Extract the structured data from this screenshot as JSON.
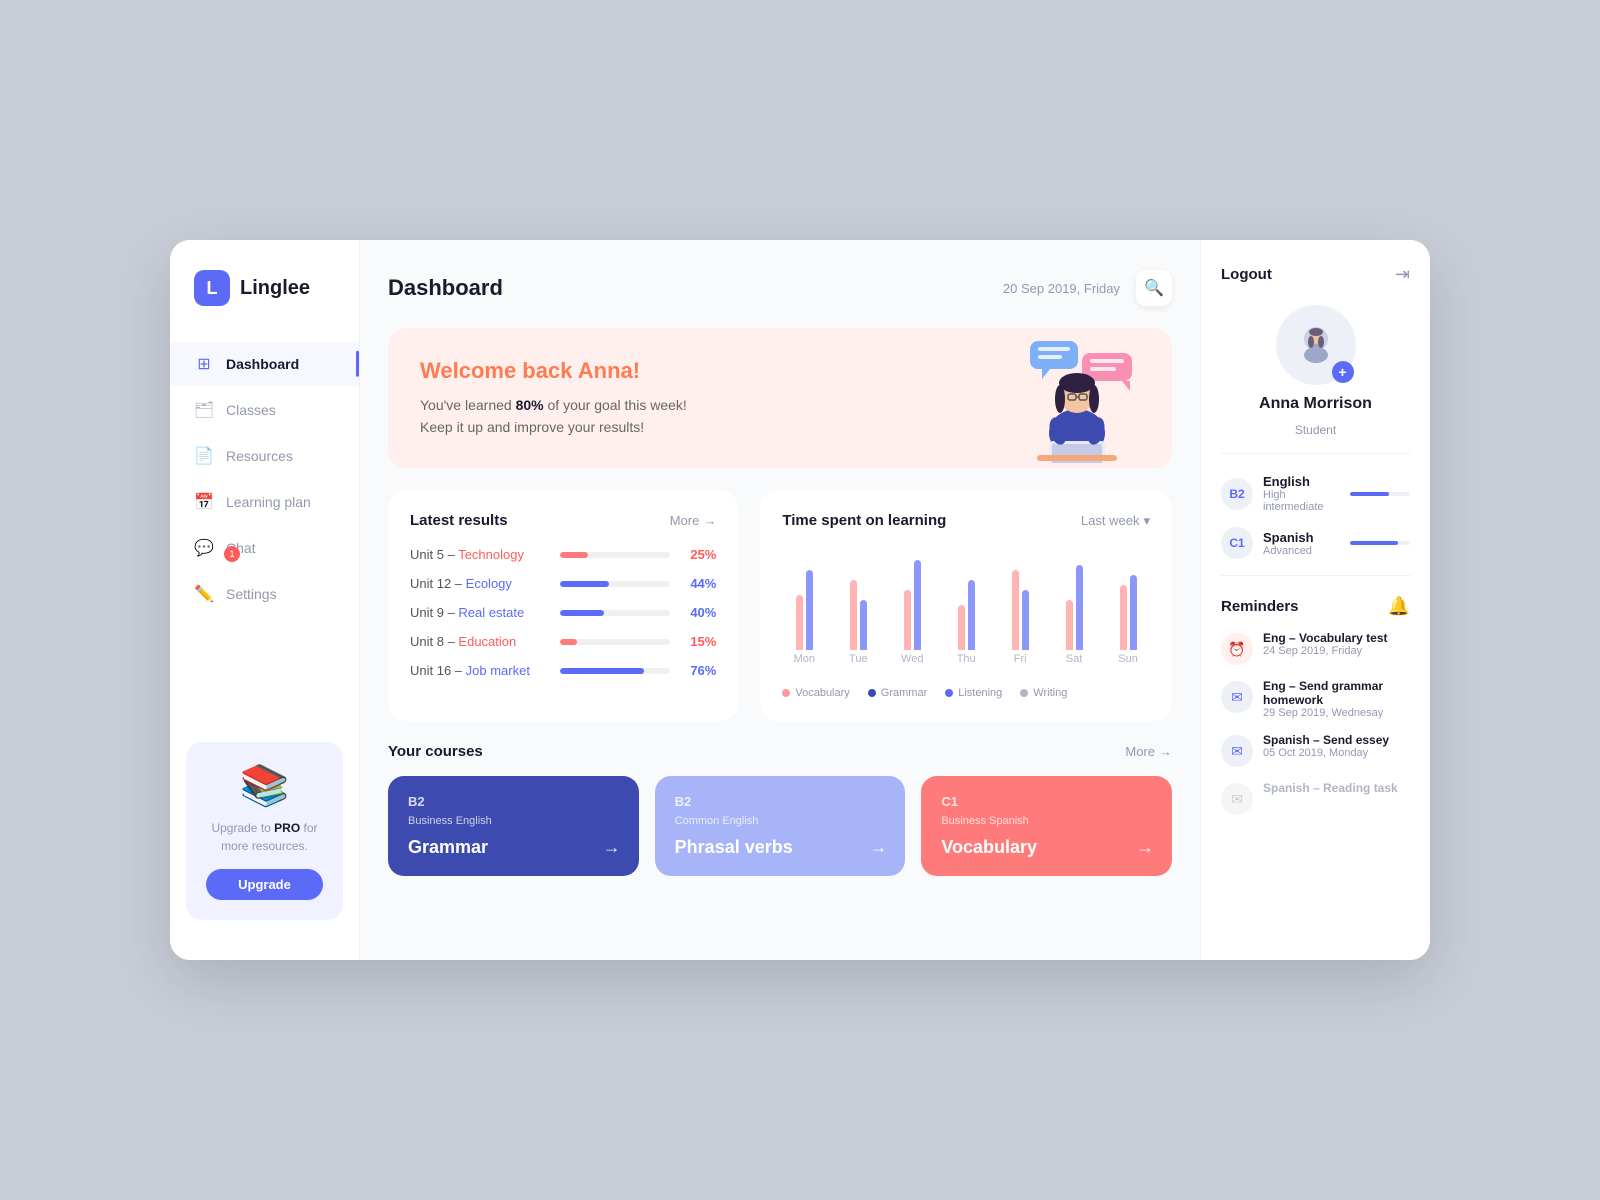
{
  "app": {
    "logo_letter": "L",
    "logo_name": "Linglee"
  },
  "sidebar": {
    "nav_items": [
      {
        "id": "dashboard",
        "label": "Dashboard",
        "icon": "⊞",
        "active": true
      },
      {
        "id": "classes",
        "label": "Classes",
        "icon": "🗂",
        "active": false
      },
      {
        "id": "resources",
        "label": "Resources",
        "icon": "📄",
        "active": false
      },
      {
        "id": "learning-plan",
        "label": "Learning plan",
        "icon": "📅",
        "active": false
      },
      {
        "id": "chat",
        "label": "Chat",
        "icon": "💬",
        "active": false,
        "badge": "1"
      },
      {
        "id": "settings",
        "label": "Settings",
        "icon": "✏️",
        "active": false
      }
    ],
    "upgrade_text_1": "Upgrade to ",
    "upgrade_text_bold": "PRO",
    "upgrade_text_2": " for more resources.",
    "upgrade_button": "Upgrade"
  },
  "header": {
    "title": "Dashboard",
    "date": "20 Sep 2019, Friday"
  },
  "welcome": {
    "greeting": "Welcome back Anna!",
    "line1": "You've learned ",
    "pct": "80%",
    "line2": " of your goal this week!",
    "line3": "Keep it up and improve your results!"
  },
  "latest_results": {
    "title": "Latest results",
    "more": "More",
    "rows": [
      {
        "label": "Unit 5 – ",
        "subject": "Technology",
        "pct": 25,
        "color": "red"
      },
      {
        "label": "Unit 12 – ",
        "subject": "Ecology",
        "pct": 44,
        "color": "blue"
      },
      {
        "label": "Unit 9 – ",
        "subject": "Real estate",
        "pct": 40,
        "color": "blue"
      },
      {
        "label": "Unit 8 – ",
        "subject": "Education",
        "pct": 15,
        "color": "red"
      },
      {
        "label": "Unit 16 – ",
        "subject": "Job market",
        "pct": 76,
        "color": "blue"
      }
    ]
  },
  "chart": {
    "title": "Time spent on learning",
    "period": "Last week",
    "days": [
      {
        "label": "Mon",
        "pink": 55,
        "blue": 80
      },
      {
        "label": "Tue",
        "pink": 70,
        "blue": 50
      },
      {
        "label": "Wed",
        "pink": 60,
        "blue": 90
      },
      {
        "label": "Thu",
        "pink": 45,
        "blue": 70
      },
      {
        "label": "Fri",
        "pink": 80,
        "blue": 60
      },
      {
        "label": "Sat",
        "pink": 50,
        "blue": 85
      },
      {
        "label": "Sun",
        "pink": 65,
        "blue": 75
      }
    ],
    "legend": [
      {
        "label": "Vocabulary",
        "color": "#ff9999"
      },
      {
        "label": "Grammar",
        "color": "#3d4ab0"
      },
      {
        "label": "Listening",
        "color": "#5B6BF8"
      },
      {
        "label": "Writing",
        "color": "#b0b5c8"
      }
    ]
  },
  "courses": {
    "title": "Your courses",
    "more": "More",
    "items": [
      {
        "level": "B2",
        "category": "Business English",
        "name": "Grammar",
        "theme": "dark"
      },
      {
        "level": "B2",
        "category": "Common English",
        "name": "Phrasal verbs",
        "theme": "light-blue"
      },
      {
        "level": "C1",
        "category": "Business Spanish",
        "name": "Vocabulary",
        "theme": "pink"
      }
    ]
  },
  "profile": {
    "logout_label": "Logout",
    "name": "Anna Morrison",
    "role": "Student",
    "languages": [
      {
        "level": "B2",
        "name": "English",
        "sublevel": "High intermediate",
        "progress": 65
      },
      {
        "level": "C1",
        "name": "Spanish",
        "sublevel": "Advanced",
        "progress": 80
      }
    ]
  },
  "reminders": {
    "title": "Reminders",
    "items": [
      {
        "name": "Eng – Vocabulary test",
        "date": "24 Sep 2019, Friday",
        "type": "red",
        "icon": "⏰"
      },
      {
        "name": "Eng – Send grammar homework",
        "date": "29 Sep 2019, Wednesay",
        "type": "blue",
        "icon": "✉"
      },
      {
        "name": "Spanish – Send essey",
        "date": "05 Oct 2019, Monday",
        "type": "blue",
        "icon": "✉"
      },
      {
        "name": "Spanish – Reading task",
        "date": "",
        "type": "faded",
        "icon": "✉"
      }
    ]
  }
}
